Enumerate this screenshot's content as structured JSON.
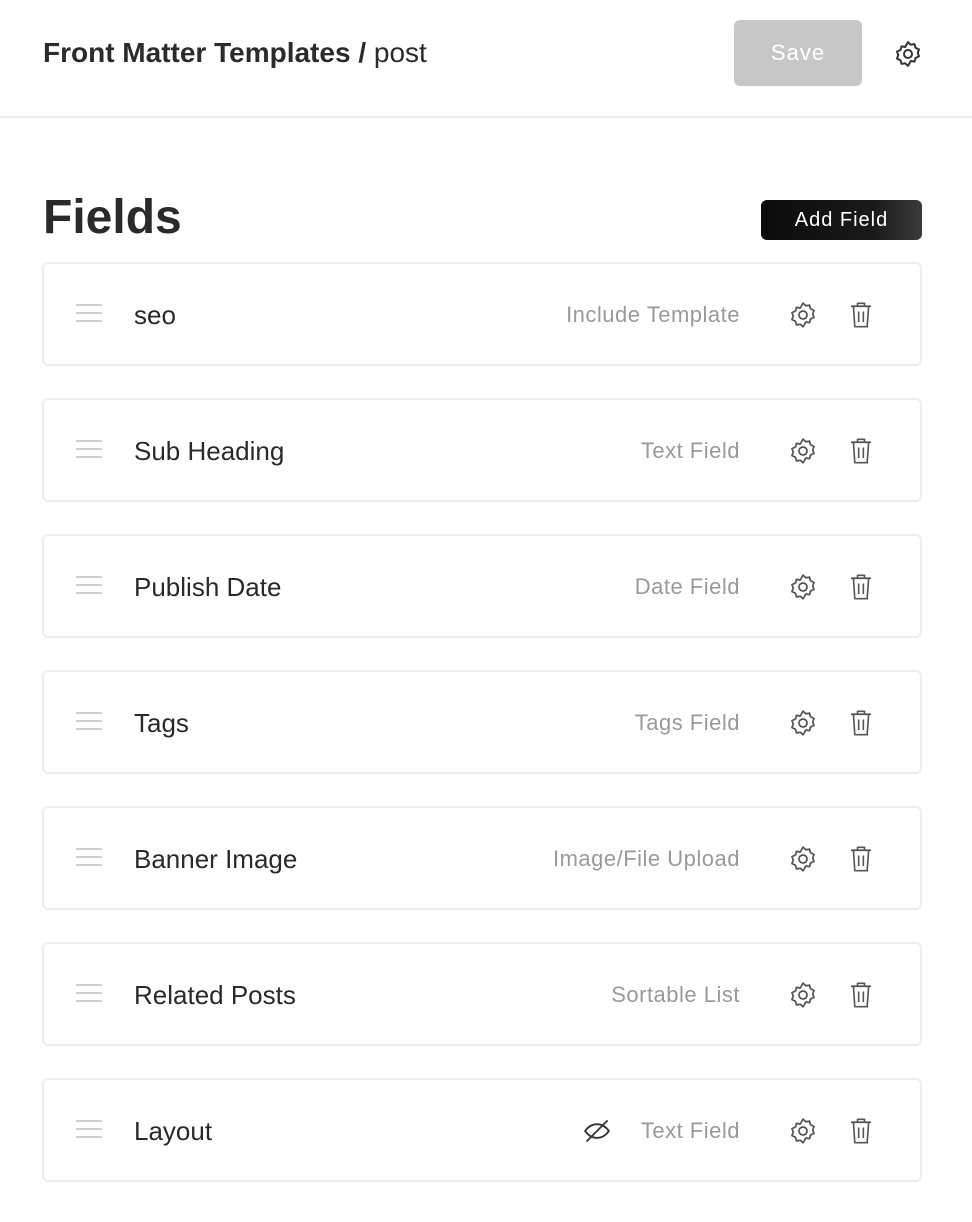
{
  "header": {
    "breadcrumb_root": "Front Matter Templates",
    "breadcrumb_separator": "/",
    "breadcrumb_current": "post",
    "save_label": "Save",
    "settings_icon": "gear-icon"
  },
  "main": {
    "title": "Fields",
    "add_field_label": "Add Field",
    "fields": [
      {
        "name": "seo",
        "type": "Include Template",
        "hidden": false
      },
      {
        "name": "Sub Heading",
        "type": "Text Field",
        "hidden": false
      },
      {
        "name": "Publish Date",
        "type": "Date Field",
        "hidden": false
      },
      {
        "name": "Tags",
        "type": "Tags Field",
        "hidden": false
      },
      {
        "name": "Banner Image",
        "type": "Image/File Upload",
        "hidden": false
      },
      {
        "name": "Related Posts",
        "type": "Sortable List",
        "hidden": false
      },
      {
        "name": "Layout",
        "type": "Text Field",
        "hidden": true
      }
    ]
  },
  "colors": {
    "save_disabled_bg": "#c7c7c7",
    "add_field_bg": "#111111",
    "border": "#eeeeee",
    "muted_text": "#9a9a9a",
    "icon_stroke": "#555555"
  }
}
